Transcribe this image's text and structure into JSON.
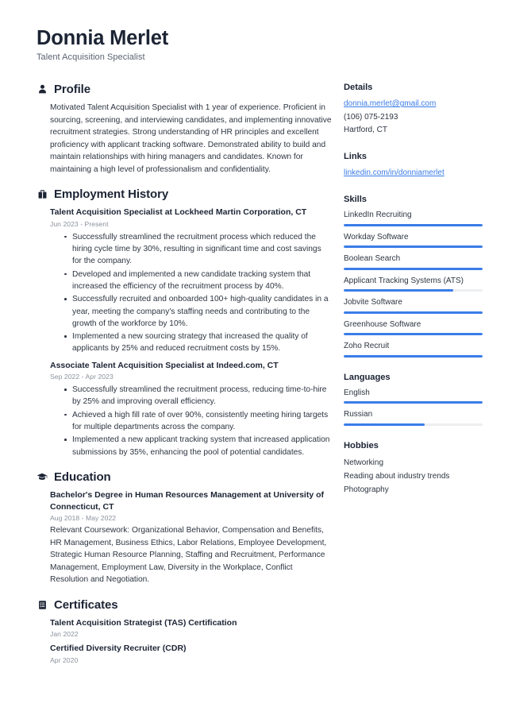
{
  "accent_color": "#3a7de8",
  "text_color": "#2d3541",
  "heading_color": "#1c2434",
  "muted_color": "#8b929d",
  "header": {
    "name": "Donnia Merlet",
    "job_title": "Talent Acquisition Specialist"
  },
  "sections": {
    "profile": {
      "icon": "user-icon",
      "title": "Profile",
      "text": "Motivated Talent Acquisition Specialist with 1 year of experience. Proficient in sourcing, screening, and interviewing candidates, and implementing innovative recruitment strategies. Strong understanding of HR principles and excellent proficiency with applicant tracking software. Demonstrated ability to build and maintain relationships with hiring managers and candidates. Known for maintaining a high level of professionalism and confidentiality."
    },
    "employment": {
      "icon": "briefcase-icon",
      "title": "Employment History",
      "entries": [
        {
          "title": "Talent Acquisition Specialist at Lockheed Martin Corporation, CT",
          "date": "Jun 2023 - Present",
          "bullets": [
            "Successfully streamlined the recruitment process which reduced the hiring cycle time by 30%, resulting in significant time and cost savings for the company.",
            "Developed and implemented a new candidate tracking system that increased the efficiency of the recruitment process by 40%.",
            "Successfully recruited and onboarded 100+ high-quality candidates in a year, meeting the company's staffing needs and contributing to the growth of the workforce by 10%.",
            "Implemented a new sourcing strategy that increased the quality of applicants by 25% and reduced recruitment costs by 15%."
          ]
        },
        {
          "title": "Associate Talent Acquisition Specialist at Indeed.com, CT",
          "date": "Sep 2022 - Apr 2023",
          "bullets": [
            "Successfully streamlined the recruitment process, reducing time-to-hire by 25% and improving overall efficiency.",
            "Achieved a high fill rate of over 90%, consistently meeting hiring targets for multiple departments across the company.",
            "Implemented a new applicant tracking system that increased application submissions by 35%, enhancing the pool of potential candidates."
          ]
        }
      ]
    },
    "education": {
      "icon": "graduation-cap-icon",
      "title": "Education",
      "entries": [
        {
          "title": "Bachelor's Degree in Human Resources Management at University of Connecticut, CT",
          "date": "Aug 2018 - May 2022",
          "description": "Relevant Coursework: Organizational Behavior, Compensation and Benefits, HR Management, Business Ethics, Labor Relations, Employee Development, Strategic Human Resource Planning, Staffing and Recruitment, Performance Management, Employment Law, Diversity in the Workplace, Conflict Resolution and Negotiation."
        }
      ]
    },
    "certificates": {
      "icon": "certificate-icon",
      "title": "Certificates",
      "entries": [
        {
          "title": "Talent Acquisition Strategist (TAS) Certification",
          "date": "Jan 2022"
        },
        {
          "title": "Certified Diversity Recruiter (CDR)",
          "date": "Apr 2020"
        }
      ]
    }
  },
  "sidebar": {
    "details": {
      "title": "Details",
      "email": "donnia.merlet@gmail.com",
      "phone": "(106) 075-2193",
      "location": "Hartford, CT"
    },
    "links": {
      "title": "Links",
      "items": [
        {
          "label": "linkedin.com/in/donniamerlet"
        }
      ]
    },
    "skills": {
      "title": "Skills",
      "items": [
        {
          "label": "LinkedIn Recruiting",
          "level": 100
        },
        {
          "label": "Workday Software",
          "level": 100
        },
        {
          "label": "Boolean Search",
          "level": 100
        },
        {
          "label": "Applicant Tracking Systems (ATS)",
          "level": 79
        },
        {
          "label": "Jobvite Software",
          "level": 100
        },
        {
          "label": "Greenhouse Software",
          "level": 100
        },
        {
          "label": "Zoho Recruit",
          "level": 100
        }
      ]
    },
    "languages": {
      "title": "Languages",
      "items": [
        {
          "label": "English",
          "level": 100
        },
        {
          "label": "Russian",
          "level": 58
        }
      ]
    },
    "hobbies": {
      "title": "Hobbies",
      "items": [
        {
          "label": "Networking"
        },
        {
          "label": "Reading about industry trends"
        },
        {
          "label": "Photography"
        }
      ]
    }
  }
}
